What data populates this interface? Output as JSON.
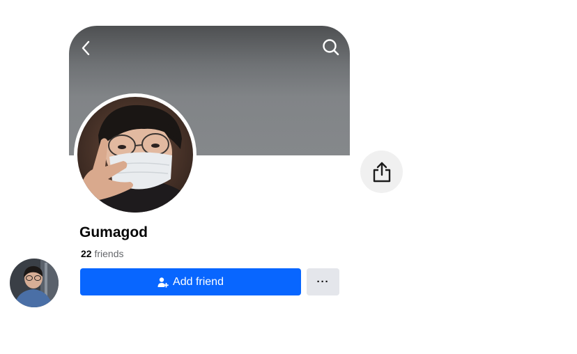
{
  "header": {
    "back_icon": "chevron-left-icon",
    "search_icon": "search-icon"
  },
  "profile": {
    "name": "Gumagod",
    "friends_count": "22",
    "friends_label": "friends"
  },
  "actions": {
    "add_friend_label": "Add friend",
    "add_friend_icon": "person-add-icon",
    "more_label": "···",
    "share_icon": "share-icon"
  },
  "colors": {
    "primary_button": "#0866ff",
    "secondary_button": "#e4e6eb",
    "share_button_bg": "#f0f0f0"
  }
}
